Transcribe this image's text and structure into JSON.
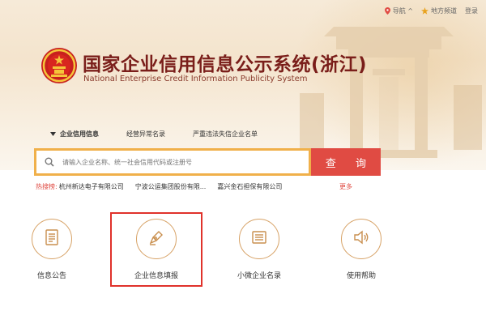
{
  "topbar": {
    "nav_label": "导航 ^",
    "local_label": "地方频道",
    "login_label": "登录"
  },
  "header": {
    "title_cn": "国家企业信用信息公示系统(浙江)",
    "title_en": "National Enterprise Credit Information Publicity System"
  },
  "tabs": [
    {
      "label": "企业信用信息"
    },
    {
      "label": "经营异常名录"
    },
    {
      "label": "严重违法失信企业名单"
    }
  ],
  "search": {
    "placeholder": "请输入企业名称、统一社会信用代码或注册号",
    "button_label": "查 询"
  },
  "hot_search": {
    "label": "热搜榜:",
    "items": [
      "杭州新达电子有限公司",
      "宁波公运集团股份有限...",
      "嘉兴金石担保有限公司"
    ],
    "more_label": "更多"
  },
  "features": [
    {
      "label": "信息公告",
      "icon": "document-icon"
    },
    {
      "label": "企业信息填报",
      "icon": "pen-icon"
    },
    {
      "label": "小微企业名录",
      "icon": "list-icon"
    },
    {
      "label": "使用帮助",
      "icon": "speaker-icon"
    }
  ],
  "colors": {
    "brand_red": "#e04b43",
    "search_border": "#f0b04a",
    "title": "#7a1e1a",
    "icon_gold": "#d7a266"
  }
}
